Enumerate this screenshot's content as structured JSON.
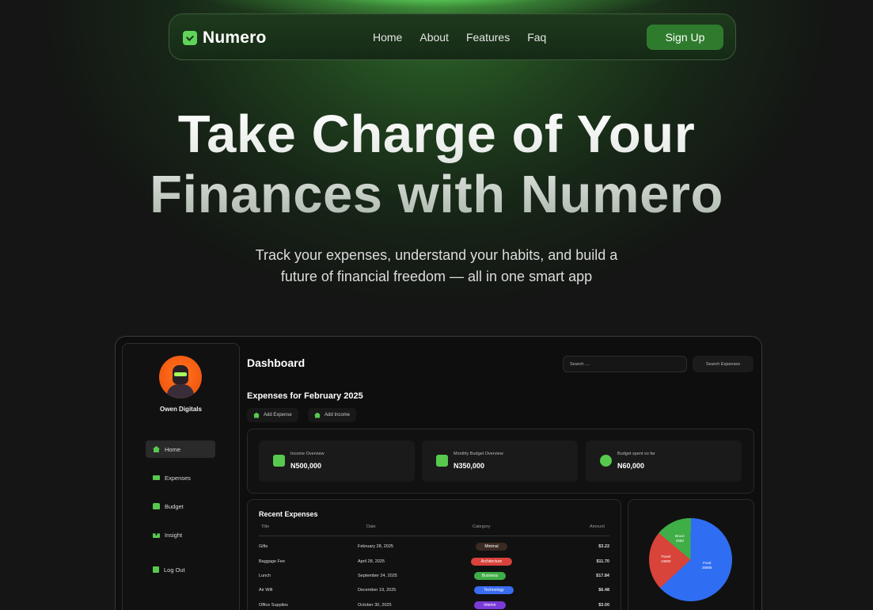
{
  "nav": {
    "brand": "Numero",
    "links": [
      "Home",
      "About",
      "Features",
      "Faq"
    ],
    "signup_label": "Sign Up"
  },
  "hero": {
    "title_line1": "Take Charge of Your",
    "title_line2": "Finances with Numero",
    "subtitle_line1": "Track your expenses, understand your habits, and build a",
    "subtitle_line2": "future of financial freedom — all in one smart app"
  },
  "dashboard": {
    "user_name": "Owen Digitals",
    "sidebar": [
      {
        "label": "Home",
        "icon": "home-icon"
      },
      {
        "label": "Expenses",
        "icon": "cash-icon"
      },
      {
        "label": "Budget",
        "icon": "bag-icon"
      },
      {
        "label": "Insight",
        "icon": "binoculars-icon"
      },
      {
        "label": "Log Out",
        "icon": "logout-icon"
      }
    ],
    "title": "Dashboard",
    "search_placeholder": "Search ....",
    "search_button": "Search Expenses",
    "expenses_heading": "Expenses for February 2025",
    "add_expense": "Add Expense",
    "add_income": "Add Income",
    "stats": [
      {
        "label": "Income Overview",
        "value": "N500,000",
        "icon": "calendar-icon"
      },
      {
        "label": "Monthly Budget Overview",
        "value": "N350,000",
        "icon": "ledger-icon"
      },
      {
        "label": "Budget spent so far",
        "value": "N60,000",
        "icon": "arrow-up-circle-icon"
      }
    ],
    "recent": {
      "title": "Recent Expenses",
      "columns": [
        "Title",
        "Date",
        "Category",
        "Amount"
      ],
      "rows": [
        {
          "title": "Gifts",
          "date": "February 28, 2025",
          "category": "Minimal",
          "color": "#3b2a22",
          "amount": "$3.22"
        },
        {
          "title": "Baggage Fee",
          "date": "April 28, 2025",
          "category": "Architecture",
          "color": "#d8423a",
          "amount": "$11.70"
        },
        {
          "title": "Lunch",
          "date": "September 24, 2025",
          "category": "Business",
          "color": "#3fae46",
          "amount": "$17.84"
        },
        {
          "title": "Air Wifi",
          "date": "December 19, 2025",
          "category": "Technology",
          "color": "#3a6cf0",
          "amount": "$6.48"
        },
        {
          "title": "Office Supplies",
          "date": "October 30, 2025",
          "category": "Interior",
          "color": "#7a3ad8",
          "amount": "$3.00"
        }
      ]
    },
    "pie": {
      "slices": [
        {
          "name": "Food",
          "value": "25808",
          "color": "#2f6ef2",
          "pct": 63
        },
        {
          "name": "Travel",
          "value": "10800",
          "color": "#d8433a",
          "pct": 23
        },
        {
          "name": "Bruce",
          "value": "2560",
          "color": "#3fae46",
          "pct": 14
        }
      ]
    }
  },
  "colors": {
    "accent": "#2f7b2e",
    "brand_green": "#5fd35a"
  }
}
